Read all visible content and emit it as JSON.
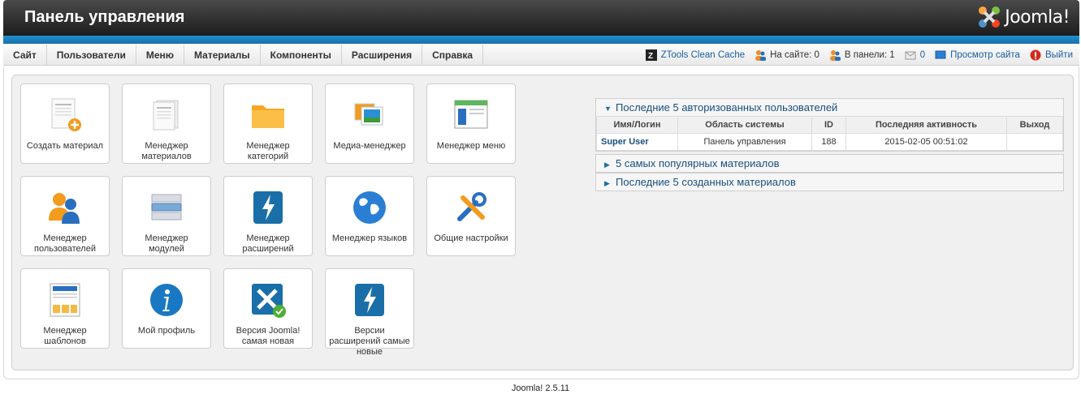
{
  "header": {
    "title": "Панель управления",
    "logo_text": "Joomla!"
  },
  "menu": {
    "items": [
      "Сайт",
      "Пользователи",
      "Меню",
      "Материалы",
      "Компоненты",
      "Расширения",
      "Справка"
    ]
  },
  "status": {
    "cache": "ZTools Clean Cache",
    "on_site": "На сайте: 0",
    "in_panel": "В панели: 1",
    "messages": "0",
    "view_site": "Просмотр сайта",
    "logout": "Выйти"
  },
  "tiles": [
    {
      "label": "Создать материал",
      "icon": "create-article-icon"
    },
    {
      "label": "Менеджер материалов",
      "icon": "article-manager-icon"
    },
    {
      "label": "Менеджер категорий",
      "icon": "category-manager-icon"
    },
    {
      "label": "Медиа-менеджер",
      "icon": "media-manager-icon"
    },
    {
      "label": "Менеджер меню",
      "icon": "menu-manager-icon"
    },
    {
      "label": "Менеджер пользователей",
      "icon": "user-manager-icon"
    },
    {
      "label": "Менеджер модулей",
      "icon": "module-manager-icon"
    },
    {
      "label": "Менеджер расширений",
      "icon": "extension-manager-icon"
    },
    {
      "label": "Менеджер языков",
      "icon": "language-manager-icon"
    },
    {
      "label": "Общие настройки",
      "icon": "global-config-icon"
    },
    {
      "label": "Менеджер шаблонов",
      "icon": "template-manager-icon"
    },
    {
      "label": "Мой профиль",
      "icon": "profile-icon"
    },
    {
      "label": "Версия Joomla! самая новая",
      "icon": "joomla-update-icon"
    },
    {
      "label": "Версии расширений самые новые",
      "icon": "extension-update-icon"
    }
  ],
  "panels": {
    "logged_users": {
      "title": "Последние 5 авторизованных пользователей",
      "columns": [
        "Имя/Логин",
        "Область системы",
        "ID",
        "Последняя активность",
        "Выход"
      ],
      "rows": [
        {
          "user": "Super User",
          "area": "Панель управления",
          "id": "188",
          "last": "2015-02-05 00:51:02",
          "logout": ""
        }
      ]
    },
    "popular": {
      "title": "5 самых популярных материалов"
    },
    "latest": {
      "title": "Последние 5 созданных материалов"
    }
  },
  "footer": {
    "version": "Joomla! 2.5.11"
  }
}
